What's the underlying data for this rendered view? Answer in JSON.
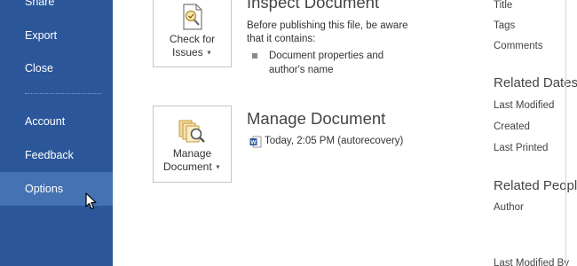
{
  "sidebar": {
    "items": [
      {
        "label": "Share"
      },
      {
        "label": "Export"
      },
      {
        "label": "Close"
      },
      {
        "label": "Account"
      },
      {
        "label": "Feedback"
      },
      {
        "label": "Options"
      }
    ],
    "active": "Options"
  },
  "inspect": {
    "title": "Inspect Document",
    "button_line1": "Check for",
    "button_line2": "Issues",
    "description_line1": "Before publishing this file, be aware",
    "description_line2": "that it contains:",
    "bullet_line1": "Document properties and",
    "bullet_line2": "author's name"
  },
  "manage": {
    "title": "Manage Document",
    "button_line1": "Manage",
    "button_line2": "Document",
    "version": "Today, 2:05 PM (autorecovery)"
  },
  "properties": {
    "title_label": "Title",
    "tags_label": "Tags",
    "comments_label": "Comments",
    "related_dates_heading": "Related Dates",
    "last_modified_label": "Last Modified",
    "created_label": "Created",
    "last_printed_label": "Last Printed",
    "related_people_heading": "Related People",
    "author_label": "Author",
    "last_modified_by_label": "Last Modified By"
  },
  "colors": {
    "sidebar_bg": "#2b579a",
    "sidebar_active": "#4472b3",
    "word_blue": "#2b579a"
  }
}
